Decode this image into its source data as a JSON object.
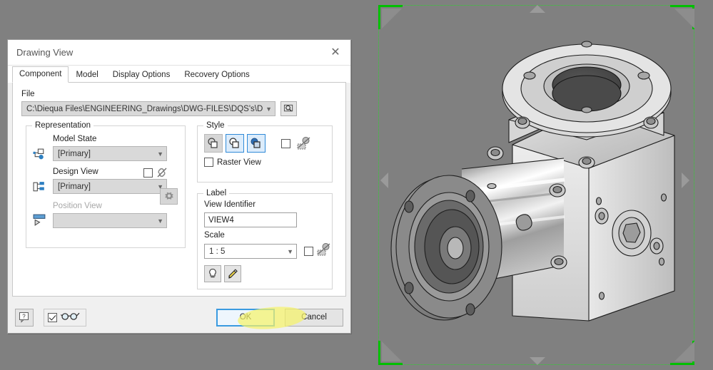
{
  "viewport": {
    "background_color": "#808080",
    "selection_frame_color": "#00c000",
    "arrow_color": "#9a9a9a",
    "model_description": "Shaded 3D CAD model of a right-angle bevel gearbox with a cylindrical input housing and flanged output"
  },
  "dialog": {
    "title": "Drawing View",
    "close_icon": "close-icon",
    "tabs": [
      {
        "label": "Component",
        "active": true
      },
      {
        "label": "Model",
        "active": false
      },
      {
        "label": "Display Options",
        "active": false
      },
      {
        "label": "Recovery Options",
        "active": false
      }
    ],
    "file": {
      "label": "File",
      "path": "C:\\Diequa Files\\ENGINEERING_Drawings\\DWG-FILES\\DQS's\\DQS",
      "browse_icon": "magnifier-browse-icon"
    },
    "representation": {
      "title": "Representation",
      "model_state": {
        "label": "Model State",
        "value": "[Primary]",
        "icon": "model-state-icon"
      },
      "design_view": {
        "label": "Design View",
        "value": "[Primary]",
        "icon": "design-view-icon",
        "associative_checked": false,
        "link_icon": "broken-link-icon",
        "settings_icon": "gear-icon"
      },
      "position_view": {
        "label": "Position View",
        "value": "",
        "icon": "position-view-icon",
        "disabled": true
      }
    },
    "style": {
      "title": "Style",
      "buttons": [
        {
          "name": "hidden-line-style",
          "state": "pressed"
        },
        {
          "name": "hidden-line-removed-style",
          "state": "selected"
        },
        {
          "name": "shaded-style",
          "state": "selected"
        }
      ],
      "style_from_base_checked": false,
      "style_from_base_icon": "style-from-base-icon",
      "raster_view": {
        "label": "Raster View",
        "checked": false
      }
    },
    "label": {
      "title": "Label",
      "view_identifier": {
        "label": "View Identifier",
        "value": "VIEW4"
      },
      "scale": {
        "label": "Scale",
        "value": "1 : 5",
        "from_base_checked": false,
        "from_base_icon": "scale-from-base-icon"
      },
      "toggle_label_button": {
        "name": "toggle-label-visibility-button",
        "icon": "lightbulb-icon"
      },
      "edit_label_button": {
        "name": "edit-label-button",
        "icon": "pencil-icon"
      }
    },
    "footer": {
      "help_label": "?",
      "help_icon": "help-icon",
      "preview": {
        "checked": true,
        "icon": "glasses-preview-icon"
      },
      "ok_label": "OK",
      "cancel_label": "Cancel",
      "ok_focused": true,
      "highlight_color": "#f5f26a"
    }
  }
}
